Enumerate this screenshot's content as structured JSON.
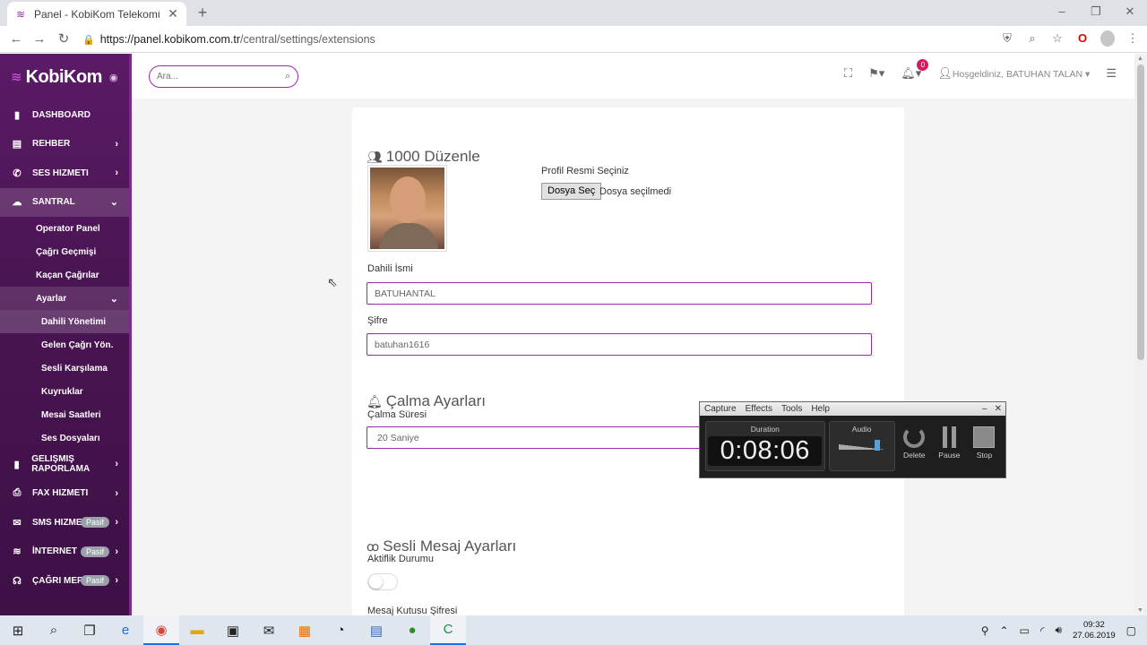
{
  "browser": {
    "tab_title": "Panel - KobiKom Telekomünikasy",
    "url_host": "https://panel.kobikom.com.tr",
    "url_path": "/central/settings/extensions"
  },
  "sidebar": {
    "logo": "KobiKom",
    "items": [
      {
        "label": "DASHBOARD",
        "icon": "bar-chart-icon"
      },
      {
        "label": "REHBER",
        "icon": "book-icon"
      },
      {
        "label": "SES HIZMETI",
        "icon": "phone-icon"
      },
      {
        "label": "SANTRAL",
        "icon": "cloud-icon"
      }
    ],
    "santral_sub": [
      "Operator Panel",
      "Çağrı Geçmişi",
      "Kaçan Çağrılar",
      "Ayarlar"
    ],
    "ayarlar_sub": [
      "Dahili Yönetimi",
      "Gelen Çağrı Yön.",
      "Sesli Karşılama",
      "Kuyruklar",
      "Mesai Saatleri",
      "Ses Dosyaları"
    ],
    "bottom_items": [
      {
        "label": "GELIŞMIŞ RAPORLAMA",
        "icon": "chart-icon",
        "badge": ""
      },
      {
        "label": "FAX HIZMETI",
        "icon": "printer-icon",
        "badge": ""
      },
      {
        "label": "SMS HIZMETI",
        "icon": "mail-icon",
        "badge": "Pasif"
      },
      {
        "label": "İNTERNET",
        "icon": "wifi-icon",
        "badge": "Pasif"
      },
      {
        "label": "ÇAĞRI MERKEZ",
        "icon": "headset-icon",
        "badge": "Pasif"
      }
    ]
  },
  "topbar": {
    "search_placeholder": "Ara...",
    "notification_count": "0",
    "welcome": "Hoşgeldiniz, BATUHAN TALAN"
  },
  "form": {
    "title": "1000 Düzenle",
    "profile_label": "Profil Resmi Seçiniz",
    "file_button": "Dosya Seç",
    "file_status": "Dosya seçilmedi",
    "name_label": "Dahili İsmi",
    "name_value": "BATUHANTAL",
    "password_label": "Şifre",
    "password_value": "batuhan1616",
    "ring_title": "Çalma Ayarları",
    "ring_duration_label": "Çalma Süresi",
    "ring_duration_value": "20 Saniye",
    "voicemail_title": "Sesli Mesaj Ayarları",
    "active_label": "Aktiflik Durumu",
    "mailbox_label": "Mesaj Kutusu Şifresi"
  },
  "capture": {
    "menu": [
      "Capture",
      "Effects",
      "Tools",
      "Help"
    ],
    "duration_label": "Duration",
    "duration": "0:08:06",
    "audio_label": "Audio",
    "delete": "Delete",
    "pause": "Pause",
    "stop": "Stop"
  },
  "taskbar": {
    "time": "09:32",
    "date": "27.06.2019"
  }
}
